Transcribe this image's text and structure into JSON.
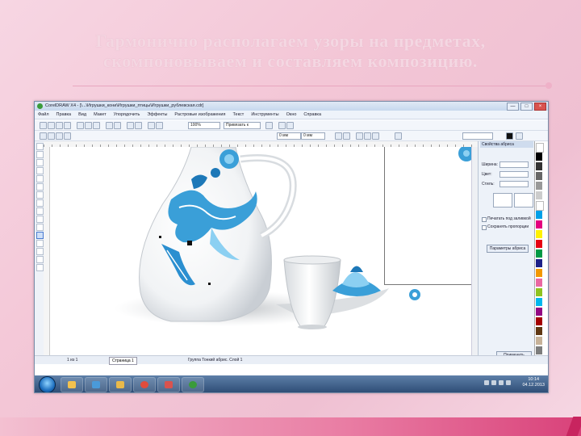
{
  "slide": {
    "title_line1": "Гармонично располагаем узоры на предметах,",
    "title_line2": "скомпоновываем и составляем композицию."
  },
  "window": {
    "title": "CorelDRAW X4 - [\\...\\Игрушки_кони\\Игрушки_птицы\\Игрушки_рублевская.cdr]",
    "controls": [
      "—",
      "□",
      "×"
    ]
  },
  "menu": {
    "items": [
      "Файл",
      "Правка",
      "Вид",
      "Макет",
      "Упорядочить",
      "Эффекты",
      "Растровые изображения",
      "Текст",
      "Инструменты",
      "Окно",
      "Справка"
    ]
  },
  "toolbar": {
    "zoom_value": "100%",
    "snap_label": "Привязать к",
    "size_x": "0 мм",
    "size_y": "0 мм"
  },
  "docker": {
    "title": "Свойства абриса",
    "width_label": "Ширина:",
    "color_label": "Цвет:",
    "style_label": "Стиль:",
    "check1": "Печатать под заливкой",
    "check2": "Сохранять пропорции",
    "button_more": "Параметры абриса",
    "apply_button": "Применить"
  },
  "status": {
    "page_info": "1 из 1",
    "page_tab": "Страница 1",
    "status_text": "Группа Тонкий абрис. Слой 1"
  },
  "clock": {
    "time": "10:14",
    "date": "04.12.2013"
  },
  "colors": {
    "accent": "#3a9fd8",
    "ornament_dark": "#1d78b8",
    "ornament_light": "#8cd0f2",
    "slide_bg": "#f3c6d6",
    "bottom_bar": "#e97ca3"
  },
  "icons": {
    "start": "windows-start-icon",
    "app": "coreldraw-icon"
  }
}
